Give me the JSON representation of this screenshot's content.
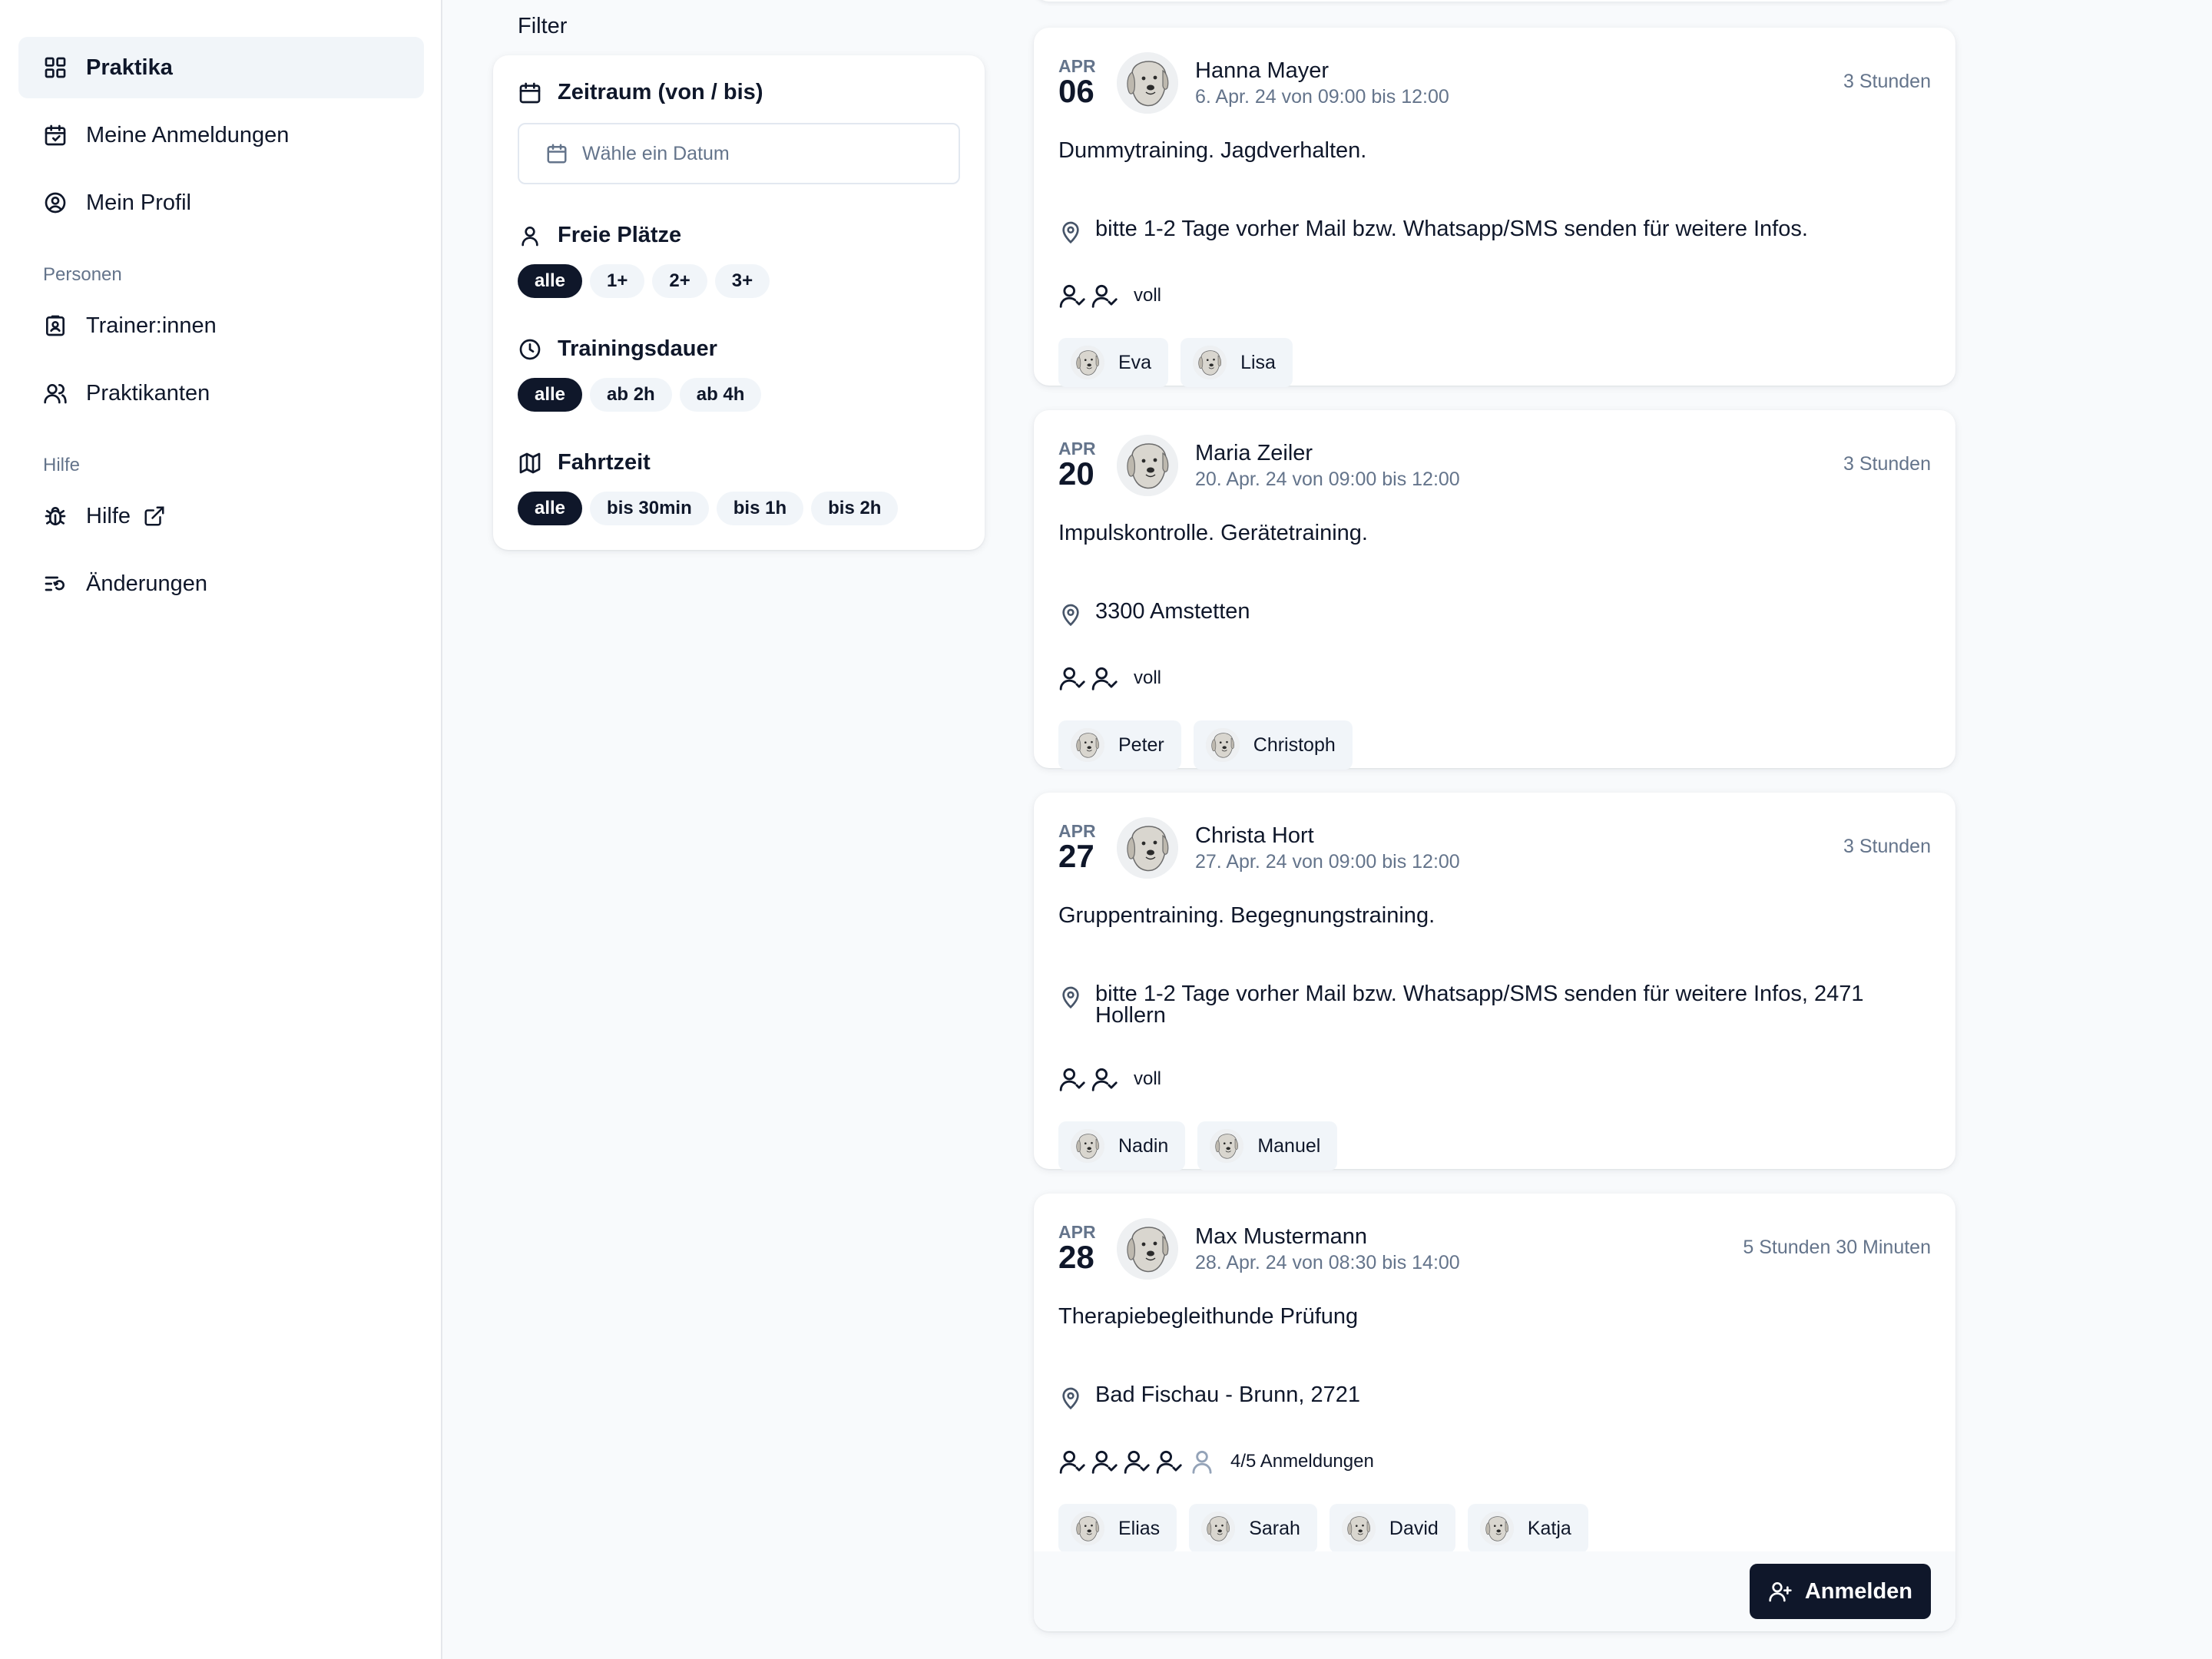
{
  "sidebar": {
    "items": [
      {
        "label": "Praktika",
        "icon": "grid-icon",
        "active": true
      },
      {
        "label": "Meine Anmeldungen",
        "icon": "calendar-icon"
      },
      {
        "label": "Mein Profil",
        "icon": "user-circle-icon"
      }
    ],
    "sections": [
      {
        "label": "Personen",
        "items": [
          {
            "label": "Trainer:innen",
            "icon": "id-badge-icon"
          },
          {
            "label": "Praktikanten",
            "icon": "users-icon"
          }
        ]
      },
      {
        "label": "Hilfe",
        "items": [
          {
            "label": "Hilfe",
            "icon": "bug-icon",
            "external": true
          },
          {
            "label": "Änderungen",
            "icon": "list-changes-icon"
          }
        ]
      }
    ]
  },
  "filter": {
    "title": "Filter",
    "zeitraum": {
      "label": "Zeitraum (von / bis)",
      "placeholder": "Wähle ein Datum"
    },
    "freie_plaetze": {
      "label": "Freie Plätze",
      "options": [
        "alle",
        "1+",
        "2+",
        "3+"
      ],
      "selected": "alle"
    },
    "trainingsdauer": {
      "label": "Trainingsdauer",
      "options": [
        "alle",
        "ab 2h",
        "ab 4h"
      ],
      "selected": "alle"
    },
    "fahrtzeit": {
      "label": "Fahrtzeit",
      "options": [
        "alle",
        "bis 30min",
        "bis 1h",
        "bis 2h"
      ],
      "selected": "alle"
    }
  },
  "events": [
    {
      "month": "APR",
      "day": "06",
      "trainer": "Hanna Mayer",
      "date_range": "6. Apr. 24 von 09:00 bis 12:00",
      "duration": "3 Stunden",
      "description": "Dummytraining. Jagdverhalten.",
      "location": "bitte 1-2 Tage vorher Mail bzw. Whatsapp/SMS senden für weitere Infos.",
      "slots_filled": 2,
      "slots_total": 2,
      "slots_text": "voll",
      "participants": [
        "Eva",
        "Lisa"
      ]
    },
    {
      "month": "APR",
      "day": "20",
      "trainer": "Maria Zeiler",
      "date_range": "20. Apr. 24 von 09:00 bis 12:00",
      "duration": "3 Stunden",
      "description": "Impulskontrolle. Gerätetraining.",
      "location": "3300 Amstetten",
      "slots_filled": 2,
      "slots_total": 2,
      "slots_text": "voll",
      "participants": [
        "Peter",
        "Christoph"
      ]
    },
    {
      "month": "APR",
      "day": "27",
      "trainer": "Christa Hort",
      "date_range": "27. Apr. 24 von 09:00 bis 12:00",
      "duration": "3 Stunden",
      "description": "Gruppentraining. Begegnungstraining.",
      "location": "bitte 1-2 Tage vorher Mail bzw. Whatsapp/SMS senden für weitere Infos, 2471 Hollern",
      "slots_filled": 2,
      "slots_total": 2,
      "slots_text": "voll",
      "participants": [
        "Nadin",
        "Manuel"
      ]
    },
    {
      "month": "APR",
      "day": "28",
      "trainer": "Max Mustermann",
      "date_range": "28. Apr. 24 von 08:30 bis 14:00",
      "duration": "5 Stunden 30 Minuten",
      "description": "Therapiebegleithunde Prüfung",
      "location": "Bad Fischau - Brunn, 2721",
      "slots_filled": 4,
      "slots_total": 5,
      "slots_text": "4/5 Anmeldungen",
      "participants": [
        "Elias",
        "Sarah",
        "David",
        "Katja"
      ],
      "action_label": "Anmelden"
    }
  ]
}
